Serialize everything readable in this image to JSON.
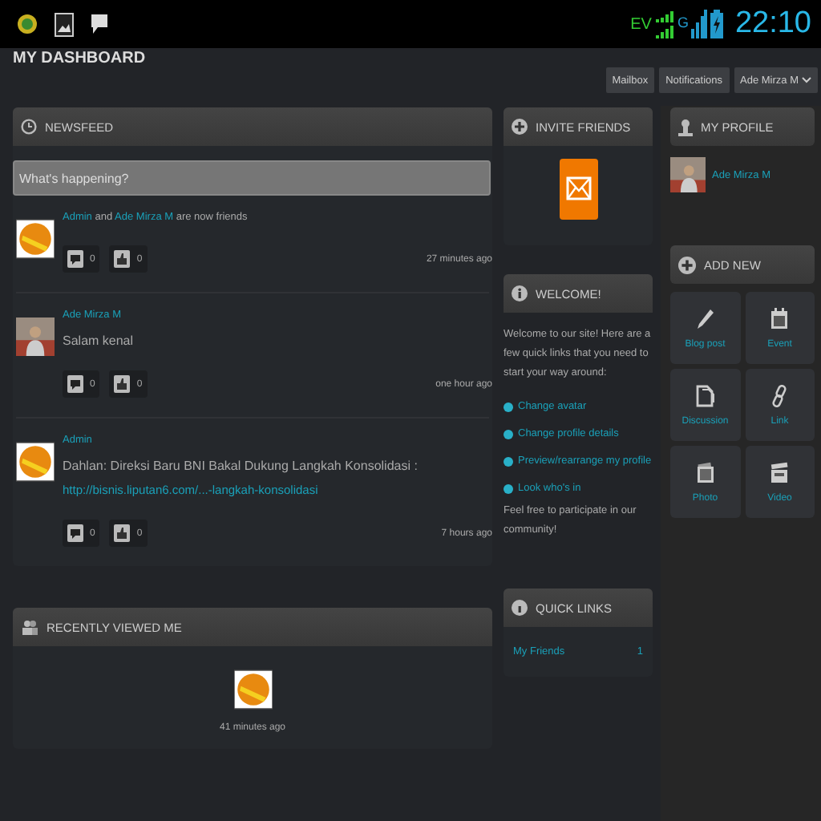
{
  "status_bar": {
    "network": "EV",
    "data_type": "G",
    "time": "22:10"
  },
  "header": {
    "title": "MY DASHBOARD",
    "buttons": [
      "Mailbox",
      "Notifications"
    ],
    "user_menu": "Ade Mirza M"
  },
  "newsfeed": {
    "title": "NEWSFEED",
    "placeholder": "What's happening?",
    "items": [
      {
        "avatar": {
          "kind": "smiley"
        },
        "segments": [
          {
            "text": "Admin",
            "link": true
          },
          {
            "text": " and ",
            "link": false
          },
          {
            "text": "Ade Mirza M",
            "link": true
          },
          {
            "text": " are now friends",
            "link": false
          }
        ],
        "comments": "0",
        "likes": "0",
        "time": "27 minutes ago"
      },
      {
        "avatar": {
          "kind": "photo"
        },
        "author": "Ade Mirza M",
        "message": "Salam kenal",
        "comments": "0",
        "likes": "0",
        "time": "one hour ago"
      },
      {
        "avatar": {
          "kind": "smiley"
        },
        "author": "Admin",
        "message": "Dahlan: Direksi Baru BNI Bakal Dukung Langkah Konsolidasi :",
        "url": "http://bisnis.liputan6.com/...-langkah-konsolidasi",
        "comments": "0",
        "likes": "0",
        "time": "7 hours ago"
      }
    ]
  },
  "recently_viewed": {
    "title": "RECENTLY VIEWED ME",
    "items": [
      {
        "avatar": {
          "kind": "smiley"
        },
        "time": "41 minutes ago"
      }
    ]
  },
  "invite": {
    "title": "INVITE FRIENDS"
  },
  "welcome": {
    "title": "WELCOME!",
    "intro": "Welcome to our site! Here are a few quick links that you need to start your way around:",
    "links": [
      "Change avatar",
      "Change profile details",
      "Preview/rearrange my profile",
      "Look who's in"
    ],
    "outro": "Feel free to participate in our community!"
  },
  "quick_links": {
    "title": "QUICK LINKS",
    "items": [
      {
        "label": "My Friends",
        "count": "1"
      }
    ]
  },
  "profile": {
    "title": "MY PROFILE",
    "name": "Ade Mirza M"
  },
  "add_new": {
    "title": "ADD NEW",
    "items": [
      {
        "kind": "pencil",
        "label": "Blog post"
      },
      {
        "kind": "calendar",
        "label": "Event"
      },
      {
        "kind": "document",
        "label": "Discussion"
      },
      {
        "kind": "link",
        "label": "Link"
      },
      {
        "kind": "photo",
        "label": "Photo"
      },
      {
        "kind": "video",
        "label": "Video"
      }
    ]
  }
}
